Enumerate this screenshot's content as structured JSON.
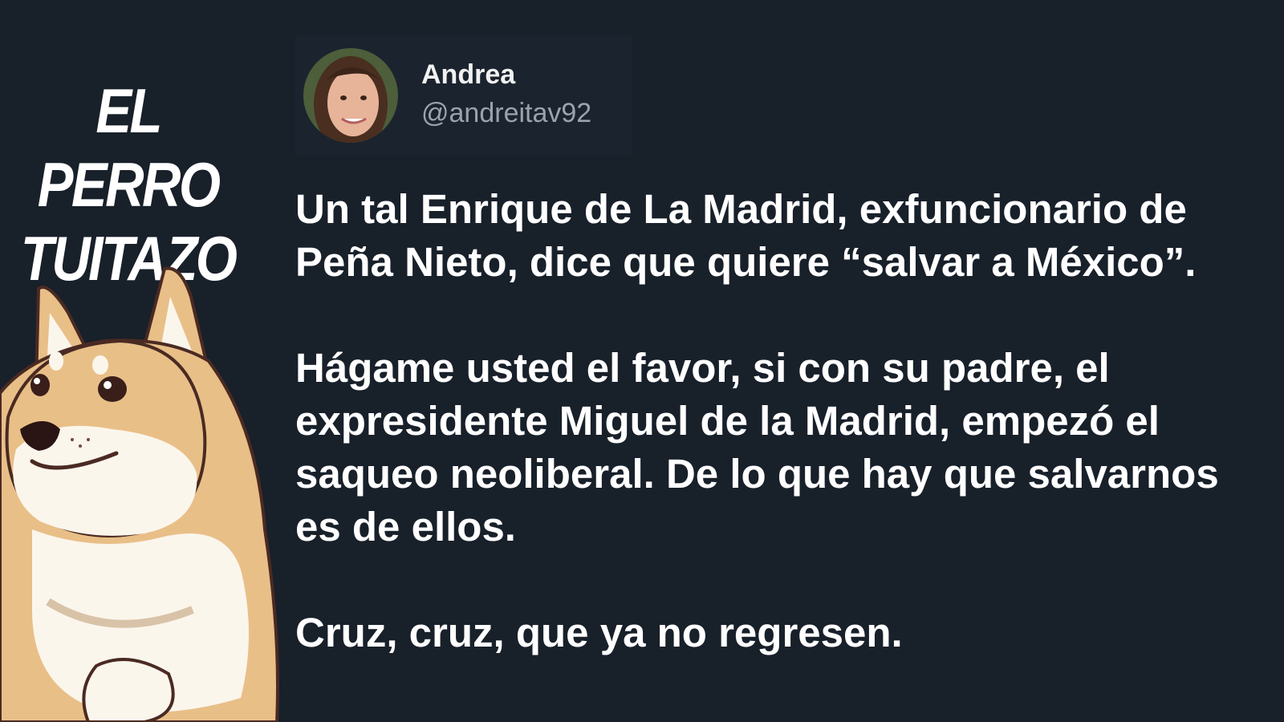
{
  "brand": {
    "line1": "EL PERRO",
    "line2": "TUITAZO"
  },
  "tweet": {
    "author_name": "Andrea",
    "author_handle": "@andreitav92",
    "paragraphs": [
      "Un tal Enrique de La Madrid, exfuncionario de Peña Nieto, dice que quiere “salvar a México”.",
      "Hágame usted el favor, si con su padre, el expresidente Miguel de la Madrid, empezó el saqueo neoliberal. De lo que hay que salvarnos es de ellos.",
      "Cruz, cruz, que ya no regresen."
    ]
  },
  "icons": {
    "mascot": "shiba-dog-mascot",
    "avatar": "user-avatar"
  },
  "colors": {
    "background": "#18202a",
    "text": "#ffffff",
    "handle": "#9aa3ad",
    "dog_fur": "#e9bf88",
    "dog_cream": "#fbf6ec"
  }
}
